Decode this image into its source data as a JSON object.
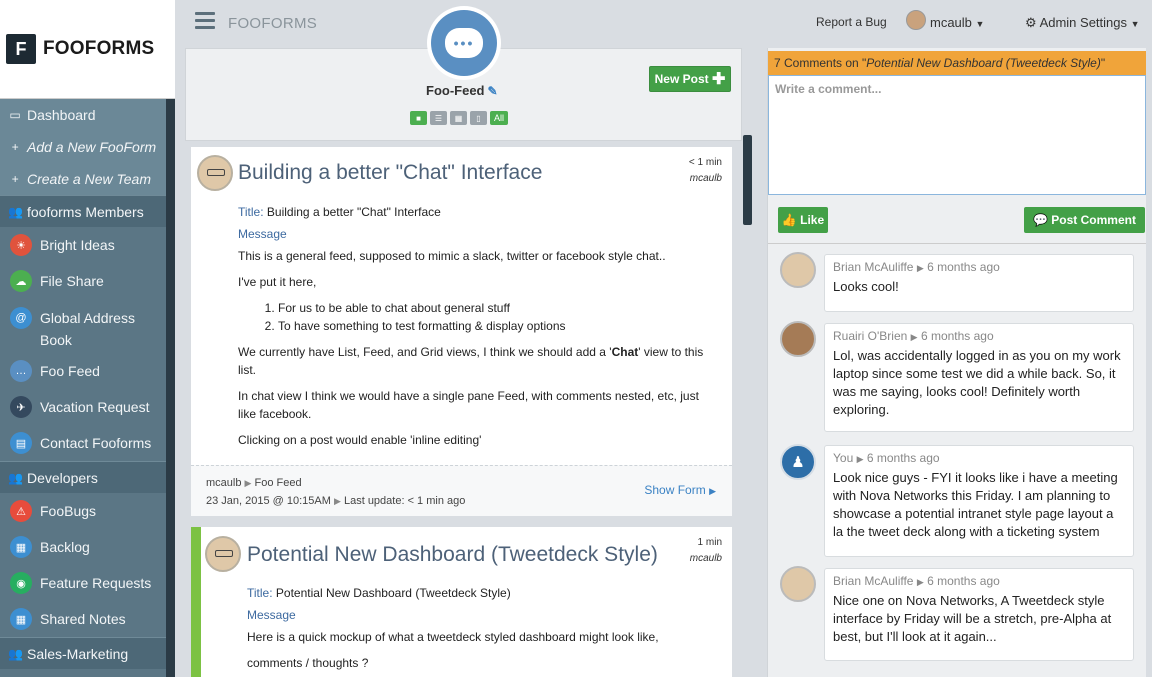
{
  "brand": {
    "name": "FOOFORMS",
    "logo_letter": "F"
  },
  "topbar": {
    "app_label": "FOOFORMS",
    "report_bug": "Report a Bug",
    "user": "mcaulb",
    "admin": "Admin Settings"
  },
  "sidebar": {
    "items": [
      {
        "label": "Dashboard",
        "icon": "monitor-icon"
      },
      {
        "label": "Add a New FooForm",
        "icon": "plus-icon"
      },
      {
        "label": "Create a New Team",
        "icon": "plus-icon"
      },
      {
        "label": "fooforms Members",
        "icon": "users-icon"
      },
      {
        "label": "Bright Ideas",
        "icon": "lightbulb-icon",
        "color": "#e0533d"
      },
      {
        "label": "File Share",
        "icon": "cloud-upload-icon",
        "color": "#4caf50"
      },
      {
        "label": "Global Address Book",
        "icon": "at-icon",
        "color": "#3d8fd1"
      },
      {
        "label": "Foo Feed",
        "icon": "chat-icon",
        "color": "#5a8fc2"
      },
      {
        "label": "Vacation Request",
        "icon": "plane-icon",
        "color": "#34495e"
      },
      {
        "label": "Contact Fooforms",
        "icon": "contact-icon",
        "color": "#3d8fd1"
      },
      {
        "label": "Developers",
        "icon": "users-icon"
      },
      {
        "label": "FooBugs",
        "icon": "warning-icon",
        "color": "#e74c3c"
      },
      {
        "label": "Backlog",
        "icon": "clipboard-icon",
        "color": "#3d8fd1"
      },
      {
        "label": "Feature Requests",
        "icon": "palette-icon",
        "color": "#27ae60"
      },
      {
        "label": "Shared Notes",
        "icon": "clipboard-icon",
        "color": "#3d8fd1"
      },
      {
        "label": "Sales-Marketing",
        "icon": "users-icon"
      }
    ]
  },
  "feed": {
    "title": "Foo-Feed",
    "new_post": "New Post",
    "view_all": "All"
  },
  "posts": [
    {
      "title": "Building a better \"Chat\" Interface",
      "time": "< 1 min",
      "author": "mcaulb",
      "field_title_label": "Title:",
      "field_title_value": "Building a better \"Chat\" Interface",
      "field_message_label": "Message",
      "p1": "This is a general feed, supposed to mimic a slack, twitter or facebook style chat..",
      "p2": "I've put it here,",
      "li1": "For us to be able to chat about general stuff",
      "li2": "To have something to test formatting & display options",
      "p3a": "We currently have List, Feed, and Grid views, I think we should add a '",
      "p3b": "Chat",
      "p3c": "' view to this list.",
      "p4": "In chat view I think we would have a single pane Feed, with comments nested, etc, just like facebook.",
      "p5": "Clicking on a post would enable 'inline editing'",
      "footer_author": "mcaulb",
      "footer_feed": "Foo Feed",
      "footer_date": "23 Jan, 2015 @ 10:15AM",
      "footer_update": "Last update: < 1 min ago",
      "show_form": "Show Form"
    },
    {
      "title": "Potential New Dashboard (Tweetdeck Style)",
      "time": "1 min",
      "author": "mcaulb",
      "field_title_label": "Title:",
      "field_title_value": "Potential New Dashboard (Tweetdeck Style)",
      "field_message_label": "Message",
      "p1": "Here is a quick mockup of what a tweetdeck styled dashboard might look like,",
      "p2": "comments / thoughts ?"
    }
  ],
  "comments_panel": {
    "header_prefix": "7 Comments on \"",
    "header_title": "Potential New Dashboard (Tweetdeck Style)",
    "header_suffix": "\"",
    "placeholder": "Write a comment...",
    "like": "Like",
    "post_comment": "Post Comment",
    "comments": [
      {
        "author": "Brian McAuliffe",
        "when": "6 months ago",
        "text": "Looks cool!"
      },
      {
        "author": "Ruairi O'Brien",
        "when": "6 months ago",
        "text": "Lol, was accidentally logged in as you on my work laptop since some test we did a while back. So, it was me saying, looks cool! Definitely worth exploring."
      },
      {
        "author": "You",
        "when": "6 months ago",
        "text": "Look nice guys - FYI it looks like i have a meeting with Nova Networks this Friday. I am planning to showcase a potential intranet style page layout a la the tweet deck along with a ticketing system"
      },
      {
        "author": "Brian McAuliffe",
        "when": "6 months ago",
        "text": "Nice one on Nova Networks, A Tweetdeck style interface by Friday will be a stretch, pre-Alpha at best, but I'll look at it again..."
      }
    ]
  }
}
